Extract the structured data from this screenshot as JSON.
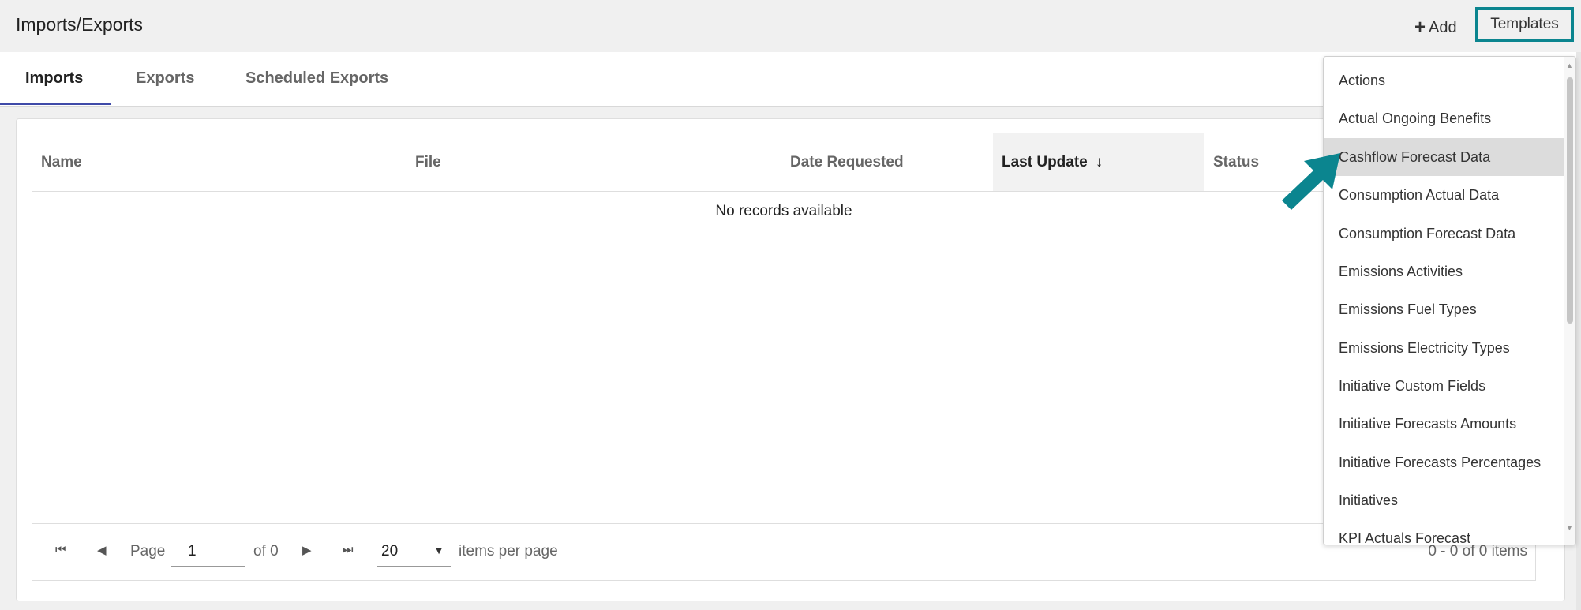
{
  "header": {
    "title": "Imports/Exports",
    "add_label": "Add",
    "templates_label": "Templates"
  },
  "tabs": [
    {
      "label": "Imports",
      "active": true
    },
    {
      "label": "Exports",
      "active": false
    },
    {
      "label": "Scheduled Exports",
      "active": false
    }
  ],
  "grid": {
    "columns": [
      "Name",
      "File",
      "Date Requested",
      "Last Update",
      "Status"
    ],
    "sorted_column": "Last Update",
    "sort_arrow": "↓",
    "empty_text": "No records available"
  },
  "pager": {
    "page_label": "Page",
    "page_value": "1",
    "of_label": "of 0",
    "per_page_value": "20",
    "per_page_label": "items per page",
    "count_text": "0 - 0 of 0 items"
  },
  "templates_menu": {
    "highlighted": "Cashflow Forecast Data",
    "items": [
      "Actions",
      "Actual Ongoing Benefits",
      "Cashflow Forecast Data",
      "Consumption Actual Data",
      "Consumption Forecast Data",
      "Emissions Activities",
      "Emissions Fuel Types",
      "Emissions Electricity Types",
      "Initiative Custom Fields",
      "Initiative Forecasts Amounts",
      "Initiative Forecasts Percentages",
      "Initiatives",
      "KPI Actuals Forecast"
    ]
  },
  "colors": {
    "accent_teal": "#0b858f",
    "tab_underline": "#3f4aa8",
    "highlight_bg": "#dcdcdc"
  },
  "icons": {
    "add": "plus-icon",
    "first_page": "first-page-icon",
    "prev_page": "previous-page-icon",
    "next_page": "next-page-icon",
    "last_page": "last-page-icon",
    "dropdown_caret": "caret-down-icon",
    "annotation": "arrow-pointer-icon"
  }
}
